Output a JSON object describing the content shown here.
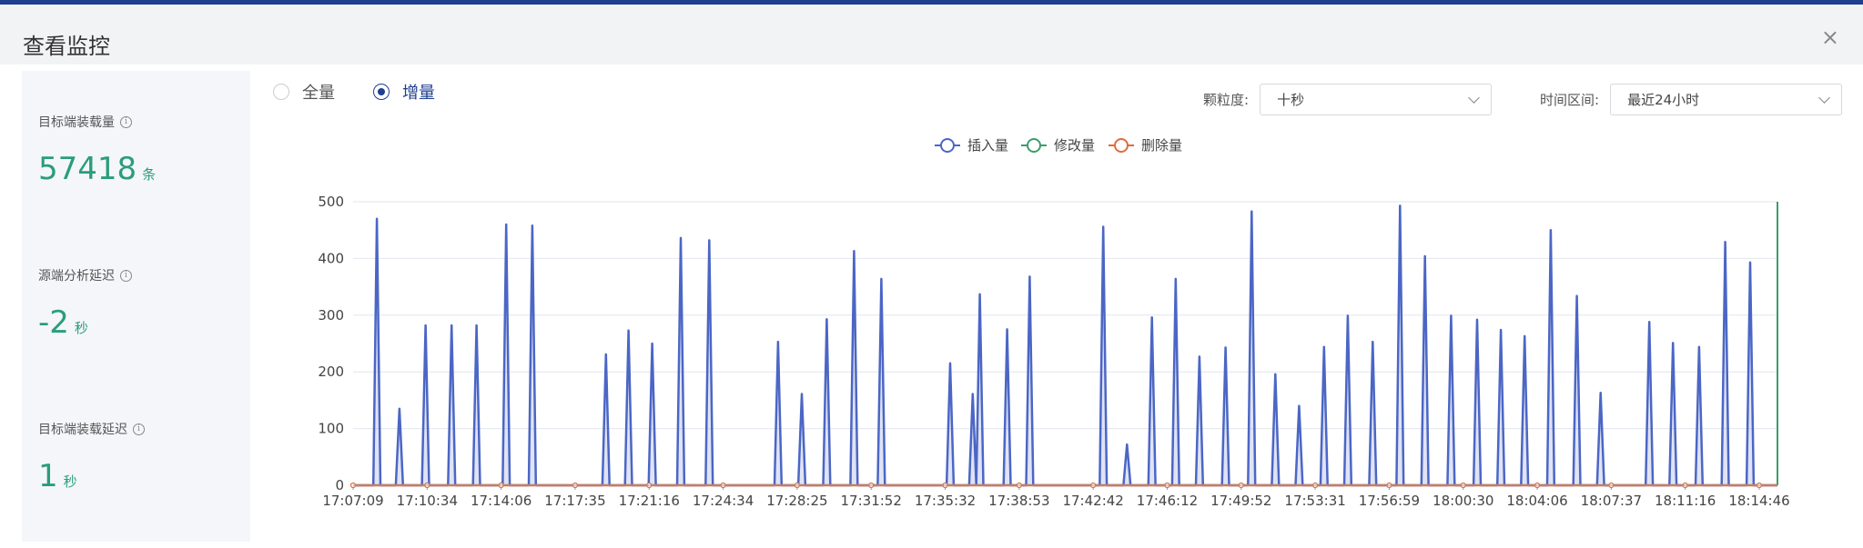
{
  "dialog": {
    "title": "查看监控",
    "close_icon": "×"
  },
  "metrics": [
    {
      "label": "目标端装载量",
      "value": "57418",
      "unit": "条"
    },
    {
      "label": "源端分析延迟",
      "value": "-2",
      "unit": "秒"
    },
    {
      "label": "目标端装载延迟",
      "value": "1",
      "unit": "秒"
    }
  ],
  "mode": {
    "options": [
      "全量",
      "增量"
    ],
    "selected": "增量"
  },
  "filters": {
    "granularity_label": "颗粒度:",
    "granularity_value": "十秒",
    "range_label": "时间区间:",
    "range_value": "最近24小时"
  },
  "colors": {
    "accent": "#1f3f8f",
    "metric": "#2a9d7c",
    "insert": "#4b66c5",
    "modify": "#3d9c6b",
    "delete": "#e06a3c"
  },
  "chart_data": {
    "type": "area",
    "legend": [
      "插入量",
      "修改量",
      "删除量"
    ],
    "legend_position": "top-center",
    "ylim": [
      0,
      500
    ],
    "yticks": [
      0,
      100,
      200,
      300,
      400,
      500
    ],
    "grid": true,
    "xticks": [
      "17:07:09",
      "17:10:34",
      "17:14:06",
      "17:17:35",
      "17:21:16",
      "17:24:34",
      "17:28:25",
      "17:31:52",
      "17:35:32",
      "17:38:53",
      "17:42:42",
      "17:46:12",
      "17:49:52",
      "17:53:31",
      "17:56:59",
      "18:00:30",
      "18:04:06",
      "18:07:37",
      "18:11:16",
      "18:14:46"
    ],
    "x_range": [
      0,
      1200
    ],
    "series": [
      {
        "name": "插入量",
        "peaks": [
          [
            20,
            470
          ],
          [
            39,
            135
          ],
          [
            61,
            282
          ],
          [
            83,
            282
          ],
          [
            104,
            282
          ],
          [
            129,
            460
          ],
          [
            151,
            458
          ],
          [
            213,
            231
          ],
          [
            232,
            273
          ],
          [
            252,
            250
          ],
          [
            276,
            436
          ],
          [
            300,
            432
          ],
          [
            358,
            253
          ],
          [
            378,
            161
          ],
          [
            399,
            293
          ],
          [
            422,
            413
          ],
          [
            445,
            364
          ],
          [
            503,
            215
          ],
          [
            522,
            161
          ],
          [
            528,
            337
          ],
          [
            551,
            275
          ],
          [
            570,
            368
          ],
          [
            632,
            456
          ],
          [
            652,
            72
          ],
          [
            673,
            296
          ],
          [
            693,
            364
          ],
          [
            713,
            227
          ],
          [
            735,
            243
          ],
          [
            757,
            483
          ],
          [
            777,
            196
          ],
          [
            797,
            140
          ],
          [
            818,
            244
          ],
          [
            838,
            299
          ],
          [
            859,
            253
          ],
          [
            882,
            493
          ],
          [
            903,
            404
          ],
          [
            925,
            299
          ],
          [
            947,
            292
          ],
          [
            967,
            274
          ],
          [
            987,
            263
          ],
          [
            1009,
            450
          ],
          [
            1031,
            334
          ],
          [
            1051,
            163
          ],
          [
            1092,
            288
          ],
          [
            1112,
            251
          ],
          [
            1134,
            244
          ],
          [
            1156,
            429
          ],
          [
            1177,
            393
          ]
        ]
      },
      {
        "name": "修改量",
        "end_value": 500
      },
      {
        "name": "删除量",
        "value": 0
      }
    ]
  }
}
